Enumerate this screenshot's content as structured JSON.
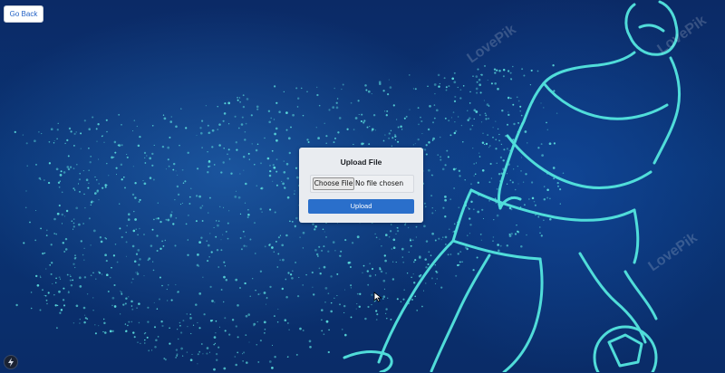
{
  "nav": {
    "go_back_label": "Go Back"
  },
  "upload_card": {
    "title": "Upload File",
    "file_input": {
      "button_label": "Choose File",
      "status_text": "No file chosen"
    },
    "submit_label": "Upload"
  },
  "background": {
    "watermark_text": "LovePik",
    "icon": "soccer-player-particle-illustration"
  },
  "colors": {
    "accent": "#2a6fcb",
    "background": "#0a2f6e",
    "particle": "#5fe3e0"
  }
}
